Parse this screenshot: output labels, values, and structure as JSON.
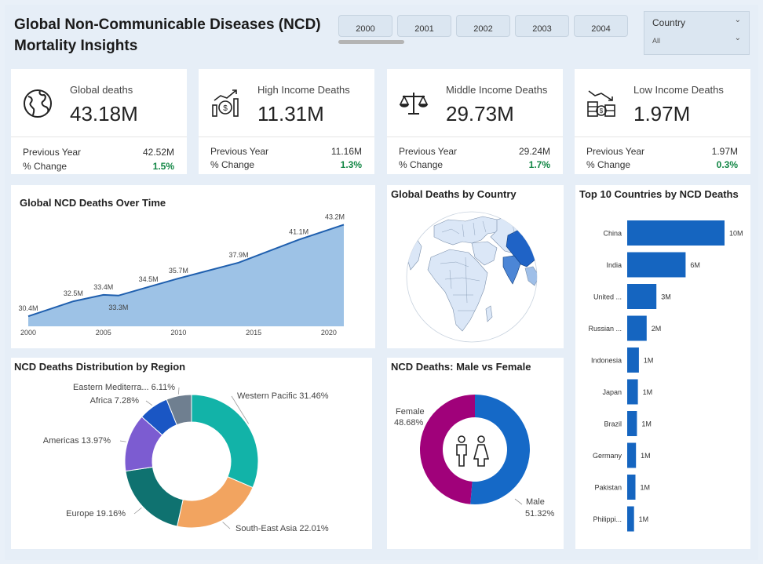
{
  "header": {
    "title_line1": "Global Non-Communicable Diseases (NCD)",
    "title_line2": "Mortality Insights"
  },
  "years": [
    "2000",
    "2001",
    "2002",
    "2003",
    "2004"
  ],
  "country_slicer": {
    "label": "Country",
    "value": "All"
  },
  "kpis": [
    {
      "title": "Global deaths",
      "value": "43.18M",
      "prev_label": "Previous Year",
      "prev_value": "42.52M",
      "change_label": "% Change",
      "change_value": "1.5%",
      "icon": "globe-icon"
    },
    {
      "title": "High Income Deaths",
      "value": "11.31M",
      "prev_label": "Previous Year",
      "prev_value": "11.16M",
      "change_label": "% Change",
      "change_value": "1.3%",
      "icon": "money-chart-icon"
    },
    {
      "title": "Middle Income Deaths",
      "value": "29.73M",
      "prev_label": "Previous Year",
      "prev_value": "29.24M",
      "change_label": "% Change",
      "change_value": "1.7%",
      "icon": "scale-icon"
    },
    {
      "title": "Low Income Deaths",
      "value": "1.97M",
      "prev_label": "Previous Year",
      "prev_value": "1.97M",
      "change_label": "% Change",
      "change_value": "0.3%",
      "icon": "declining-money-icon"
    }
  ],
  "colors": {
    "area_fill": "#9dc2e6",
    "area_line": "#1f5fae",
    "bar": "#1565c0",
    "female": "#a0017a",
    "male": "#1569c7",
    "green": "#118644",
    "map_highlight": "#1f63c6",
    "map_land": "#dbe7f7"
  },
  "area_chart": {
    "title": "Global NCD Deaths Over Time",
    "x_ticks": [
      "2000",
      "2005",
      "2010",
      "2015",
      "2020"
    ],
    "x_range": [
      2000,
      2021
    ],
    "y_range": [
      29,
      45
    ],
    "labels": [
      {
        "year": 2000,
        "value": 30.4,
        "text": "30.4M"
      },
      {
        "year": 2003,
        "value": 32.5,
        "text": "32.5M"
      },
      {
        "year": 2005,
        "value": 33.4,
        "text": "33.4M"
      },
      {
        "year": 2006,
        "value": 33.3,
        "text": "33.3M"
      },
      {
        "year": 2008,
        "value": 34.5,
        "text": "34.5M"
      },
      {
        "year": 2010,
        "value": 35.7,
        "text": "35.7M"
      },
      {
        "year": 2014,
        "value": 37.9,
        "text": "37.9M"
      },
      {
        "year": 2018,
        "value": 41.1,
        "text": "41.1M"
      },
      {
        "year": 2021,
        "value": 43.2,
        "text": "43.2M"
      }
    ]
  },
  "map": {
    "title": "Global Deaths by Country"
  },
  "top10": {
    "title": "Top 10 Countries by NCD Deaths",
    "categories": [
      "China",
      "India",
      "United ...",
      "Russian ...",
      "Indonesia",
      "Japan",
      "Brazil",
      "Germany",
      "Pakistan",
      "Philippi..."
    ],
    "values": [
      10,
      6,
      3,
      2,
      1.2,
      1.1,
      1.0,
      0.9,
      0.85,
      0.7
    ],
    "labels": [
      "10M",
      "6M",
      "3M",
      "2M",
      "1M",
      "1M",
      "1M",
      "1M",
      "1M",
      "1M"
    ]
  },
  "region_donut": {
    "title": "NCD Deaths Distribution by Region",
    "slices": [
      {
        "name": "Western Pacific",
        "label": "Western Pacific 31.46%",
        "value": 31.46,
        "color": "#12b3a8"
      },
      {
        "name": "South-East Asia",
        "label": "South-East Asia 22.01%",
        "value": 22.01,
        "color": "#f2a460"
      },
      {
        "name": "Europe",
        "label": "Europe 19.16%",
        "value": 19.16,
        "color": "#0f7270"
      },
      {
        "name": "Americas",
        "label": "Americas 13.97%",
        "value": 13.97,
        "color": "#7c5cd1"
      },
      {
        "name": "Africa",
        "label": "Africa 7.28%",
        "value": 7.28,
        "color": "#1a56c4"
      },
      {
        "name": "Eastern Mediterra...",
        "label": "Eastern Mediterra... 6.11%",
        "value": 6.11,
        "color": "#6f7f90"
      }
    ]
  },
  "gender_donut": {
    "title": "NCD Deaths: Male vs Female",
    "female_label": "Female",
    "female_pct": "48.68%",
    "female_value": 48.68,
    "male_label": "Male",
    "male_pct": "51.32%",
    "male_value": 51.32
  }
}
